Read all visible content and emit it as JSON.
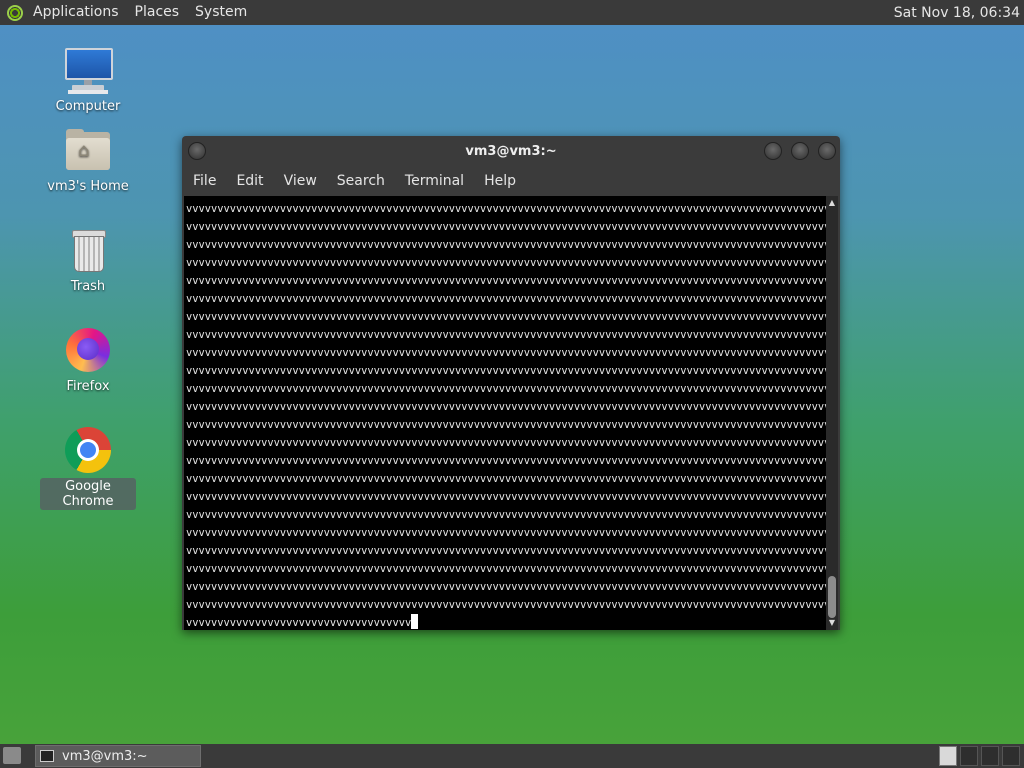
{
  "top_panel": {
    "menus": [
      "Applications",
      "Places",
      "System"
    ],
    "clock": "Sat Nov 18, 06:34"
  },
  "desktop_icons": [
    {
      "label": "Computer",
      "icon": "computer-icon"
    },
    {
      "label": "vm3's Home",
      "icon": "home-folder-icon"
    },
    {
      "label": "Trash",
      "icon": "trash-icon"
    },
    {
      "label": "Firefox",
      "icon": "firefox-icon"
    },
    {
      "label": "Google Chrome",
      "icon": "chrome-icon",
      "selected": true
    }
  ],
  "terminal": {
    "title": "vm3@vm3:~",
    "menus": [
      "File",
      "Edit",
      "View",
      "Search",
      "Terminal",
      "Help"
    ],
    "full_line": "vvvvvvvvvvvvvvvvvvvvvvvvvvvvvvvvvvvvvvvvvvvvvvvvvvvvvvvvvvvvvvvvvvvvvvvvvvvvvvvvvvvvvvvvvvvvvvvvvvvvvvvvvvvvvvvvvvvvvvvvvvvvvvvvvvvvvvvvvvvvvvvvvvvvvvvvvvvvvvvvvvvvvvvvvvvvvvvvvvvvvvvvvvvvvvvvvvvvvvvvvvvvvvvvvvvvvvvvvvvvvvvvvvvvvvvvvvvvvvvv",
    "full_line_count": 23,
    "last_line": "vvvvvvvvvvvvvvvvvvvvvvvvvvvvvvvvvvvv"
  },
  "taskbar": {
    "tasks": [
      {
        "label": "vm3@vm3:~"
      }
    ],
    "workspaces": 4,
    "active_workspace": 1
  }
}
